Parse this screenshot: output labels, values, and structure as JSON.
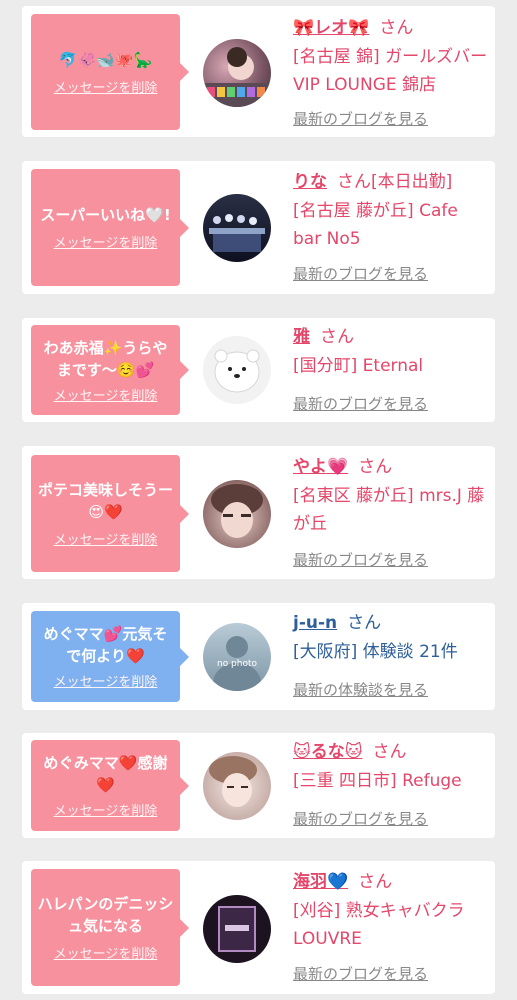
{
  "delete_label": "メッセージを削除",
  "san": "さん",
  "entries": [
    {
      "message": "🐬🦑🐋🐙🦕",
      "name": "🎀レオ🎀",
      "suffix": "",
      "shop": "[名古屋 錦] ガールズバー VIP LOUNGE 錦店",
      "link": "最新のブログを見る"
    },
    {
      "message": "スーパーいいね🤍!",
      "name": "りな",
      "suffix": "[本日出勤]",
      "shop": "[名古屋 藤が丘] Cafe bar No5",
      "link": "最新のブログを見る"
    },
    {
      "message": "わあ赤福✨うらやまです〜☺️💕",
      "name": "雅",
      "suffix": "",
      "shop": "[国分町] Eternal",
      "link": "最新のブログを見る"
    },
    {
      "message": "ポテコ美味しそうー😍❤️",
      "name": "やよ💗",
      "suffix": "",
      "shop": "[名東区 藤が丘] mrs.J 藤が丘",
      "link": "最新のブログを見る"
    },
    {
      "message": "めぐママ💕元気そで何より❤️",
      "name": "j-u-n",
      "suffix": "",
      "shop": "[大阪府] 体験談 21件",
      "link": "最新の体験談を見る",
      "avatar_text": "no photo"
    },
    {
      "message": "めぐみママ❤️感謝❤️",
      "name": "🐱るな🐱",
      "suffix": "",
      "shop": "[三重 四日市] Refuge",
      "link": "最新のブログを見る"
    },
    {
      "message": "ハレパンのデニッシュ気になる",
      "name": "海羽💙",
      "suffix": "",
      "shop": "[刈谷] 熟女キャバクラ LOUVRE",
      "link": "最新のブログを見る"
    }
  ],
  "colors": {
    "pink": "#f8919e",
    "blue": "#7fb0ef",
    "name_pink": "#e4476a",
    "name_blue": "#2e5f9a"
  }
}
